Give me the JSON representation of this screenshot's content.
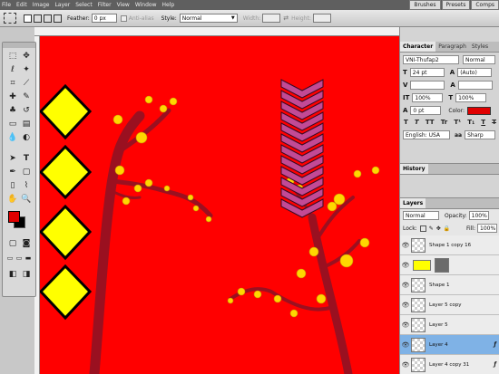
{
  "menu": {
    "items": [
      "File",
      "Edit",
      "Image",
      "Layer",
      "Select",
      "Filter",
      "View",
      "Window",
      "Help"
    ]
  },
  "panel_tray": {
    "tabs": [
      "Brushes",
      "Presets",
      "Comps"
    ]
  },
  "options_bar": {
    "feather_label": "Feather:",
    "feather_value": "0 px",
    "antialias_label": "Anti-alias",
    "style_label": "Style:",
    "style_value": "Normal",
    "width_label": "Width:",
    "height_label": "Height:"
  },
  "character_panel": {
    "tabs": [
      "Character",
      "Paragraph",
      "Styles"
    ],
    "font_family": "VNI-Thufap2",
    "font_style": "Normal",
    "font_size": "24 pt",
    "leading": "(Auto)",
    "vertical_scale": "100%",
    "horizontal_scale": "100%",
    "baseline_shift": "0 pt",
    "color_label": "Color:",
    "color_value": "#e00000",
    "language": "English: USA",
    "aa_label": "aa",
    "antialias": "Sharp"
  },
  "history_panel": {
    "title": "History"
  },
  "layers_panel": {
    "title": "Layers",
    "blend_mode": "Normal",
    "opacity_label": "Opacity:",
    "opacity_value": "100%",
    "lock_label": "Lock:",
    "fill_label": "Fill:",
    "fill_value": "100%",
    "effects_label": "Effects",
    "layers": [
      {
        "name": "Shape 1 copy 16",
        "selected": false,
        "has_fx": false,
        "thumb": "checker"
      },
      {
        "name": "",
        "selected": false,
        "has_fx": false,
        "thumb": "yellow"
      },
      {
        "name": "Shape 1",
        "selected": false,
        "has_fx": false,
        "thumb": "checker"
      },
      {
        "name": "Layer 5 copy",
        "selected": false,
        "has_fx": false,
        "thumb": "checker"
      },
      {
        "name": "Layer 5",
        "selected": false,
        "has_fx": false,
        "thumb": "checker"
      },
      {
        "name": "Layer 4",
        "selected": true,
        "has_fx": true,
        "thumb": "checker"
      },
      {
        "name": "Layer 4 copy 31",
        "selected": false,
        "has_fx": true,
        "thumb": "checker"
      }
    ]
  },
  "colors": {
    "canvas_red": "#ff0000",
    "diamond_yellow": "#ffff00",
    "branch": "#9a1020",
    "blossom": "#ffd700",
    "firecracker": "#c24a95",
    "selection_blue": "#7fb2e6"
  }
}
